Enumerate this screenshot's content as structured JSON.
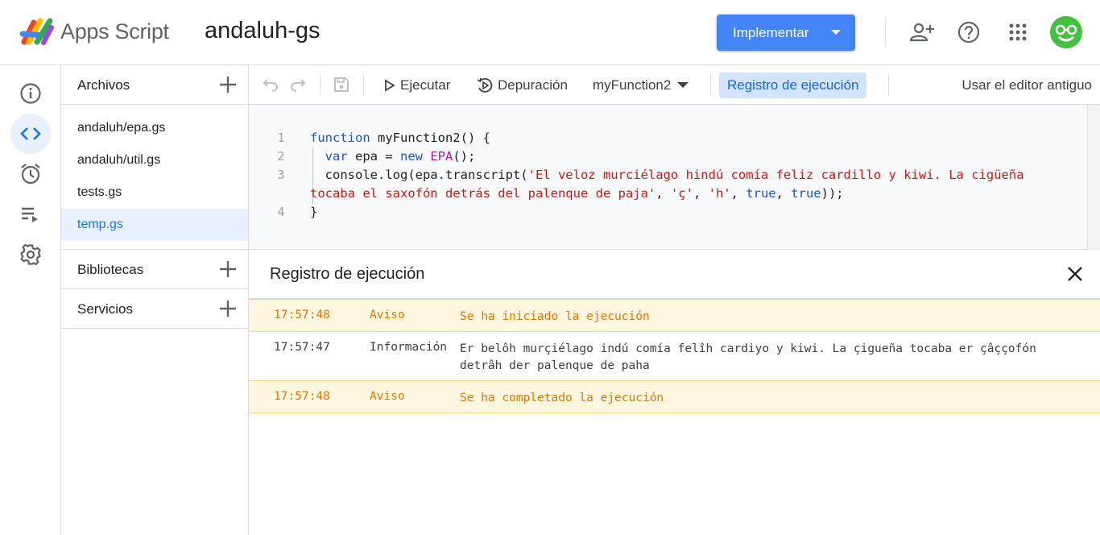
{
  "header": {
    "brand": "Apps Script",
    "project_name": "andaluh-gs",
    "deploy_label": "Implementar",
    "icons": [
      "person-add-icon",
      "help-icon",
      "apps-grid-icon",
      "avatar"
    ]
  },
  "rail": {
    "items": [
      {
        "name": "overview",
        "icon": "info-icon"
      },
      {
        "name": "editor",
        "icon": "code-icon",
        "active": true
      },
      {
        "name": "triggers",
        "icon": "alarm-icon"
      },
      {
        "name": "executions",
        "icon": "playlist-play-icon"
      },
      {
        "name": "settings",
        "icon": "gear-icon"
      }
    ]
  },
  "files": {
    "header": "Archivos",
    "items": [
      "andaluh/epa.gs",
      "andaluh/util.gs",
      "tests.gs",
      "temp.gs"
    ],
    "active_index": 3,
    "libraries": "Bibliotecas",
    "services": "Servicios"
  },
  "toolbar": {
    "run": "Ejecutar",
    "debug": "Depuración",
    "function_name": "myFunction2",
    "log_button": "Registro de ejecución",
    "legacy": "Usar el editor antiguo"
  },
  "editor": {
    "line_numbers": [
      "1",
      "2",
      "3",
      "4"
    ]
  },
  "log": {
    "title": "Registro de ejecución",
    "rows": [
      {
        "time": "17:57:48",
        "level": "Aviso",
        "message": "Se ha iniciado la ejecución",
        "type": "warn"
      },
      {
        "time": "17:57:47",
        "level": "Información",
        "message": "Er belôh murçiélago indú comía felîh cardiyo y kiwi. La çigueña tocaba er çâççofón detrâh der palenque de paha",
        "type": "info"
      },
      {
        "time": "17:57:48",
        "level": "Aviso",
        "message": "Se ha completado la ejecución",
        "type": "warn"
      }
    ]
  },
  "colors": {
    "accent": "#1a73e8",
    "deploy_button": "#4285f4",
    "warning_bg": "#fef7e0",
    "warning_text": "#e37400"
  }
}
